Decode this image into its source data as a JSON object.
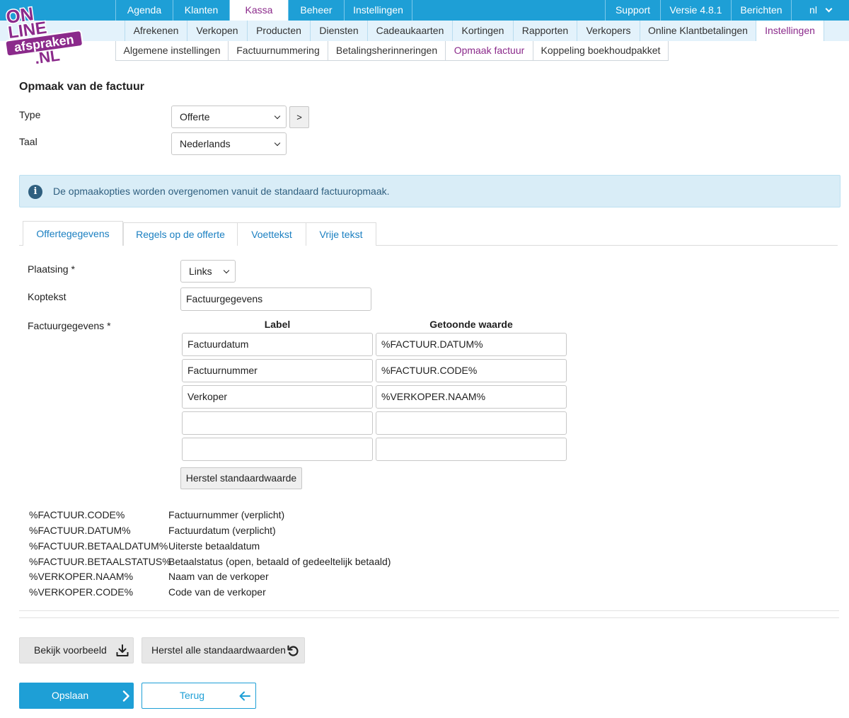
{
  "logo": {
    "line1": "ON",
    "line2": "LINE",
    "line3": "afspraken",
    "line4": ".NL"
  },
  "nav_main": {
    "items": [
      "Agenda",
      "Klanten",
      "Kassa",
      "Beheer",
      "Instellingen"
    ],
    "right": [
      "Support",
      "Versie 4.8.1",
      "Berichten"
    ],
    "lang": "nl"
  },
  "nav_sub": {
    "items": [
      "Afrekenen",
      "Verkopen",
      "Producten",
      "Diensten",
      "Cadeaukaarten",
      "Kortingen",
      "Rapporten",
      "Verkopers",
      "Online Klantbetalingen",
      "Instellingen"
    ]
  },
  "nav_sub2": {
    "items": [
      "Algemene instellingen",
      "Factuurnummering",
      "Betalingsherinneringen",
      "Opmaak factuur",
      "Koppeling boekhoudpakket"
    ]
  },
  "page": {
    "title": "Opmaak van de factuur",
    "type_label": "Type",
    "type_value": "Offerte",
    "next_btn": ">",
    "lang_label": "Taal",
    "lang_value": "Nederlands",
    "info_icon": "i",
    "info_text": "De opmaakopties worden overgenomen vanuit de standaard factuuropmaak."
  },
  "tabs": [
    "Offertegegevens",
    "Regels op de offerte",
    "Voettekst",
    "Vrije tekst"
  ],
  "form": {
    "placement_label": "Plaatsing *",
    "placement_value": "Links",
    "header_label": "Koptekst",
    "header_value": "Factuurgegevens",
    "fields_label": "Factuurgegevens *",
    "col_label": "Label",
    "col_value": "Getoonde waarde",
    "rows": [
      {
        "label": "Factuurdatum",
        "value": "%FACTUUR.DATUM%"
      },
      {
        "label": "Factuurnummer",
        "value": "%FACTUUR.CODE%"
      },
      {
        "label": "Verkoper",
        "value": "%VERKOPER.NAAM%"
      },
      {
        "label": "",
        "value": ""
      },
      {
        "label": "",
        "value": ""
      }
    ],
    "reset_btn": "Herstel standaardwaarde"
  },
  "legend": [
    {
      "code": "%FACTUUR.CODE%",
      "desc": "Factuurnummer (verplicht)"
    },
    {
      "code": "%FACTUUR.DATUM%",
      "desc": "Factuurdatum (verplicht)"
    },
    {
      "code": "%FACTUUR.BETAALDATUM%",
      "desc": "Uiterste betaaldatum"
    },
    {
      "code": "%FACTUUR.BETAALSTATUS%",
      "desc": "Betaalstatus (open, betaald of gedeeltelijk betaald)"
    },
    {
      "code": "%VERKOPER.NAAM%",
      "desc": "Naam van de verkoper"
    },
    {
      "code": "%VERKOPER.CODE%",
      "desc": "Code van de verkoper"
    }
  ],
  "actions": {
    "preview": "Bekijk voorbeeld",
    "reset_all": "Herstel alle standaardwaarden",
    "save": "Opslaan",
    "back": "Terug"
  },
  "icons": {
    "preview": "download-icon",
    "reset_all": "undo-icon",
    "save": "chevron-right-icon",
    "back": "arrow-left-icon",
    "lang": "chevron-down-icon",
    "info": "info-icon"
  },
  "colors": {
    "brand_blue": "#1e9fd6",
    "nav_sub_bg": "#e3f2fb",
    "active_purple": "#8b2a8b",
    "logo_purple": "#8b2a8b",
    "info_bg": "#d9edf7",
    "info_text": "#2f5f7f",
    "link_blue": "#1a7fc1"
  }
}
